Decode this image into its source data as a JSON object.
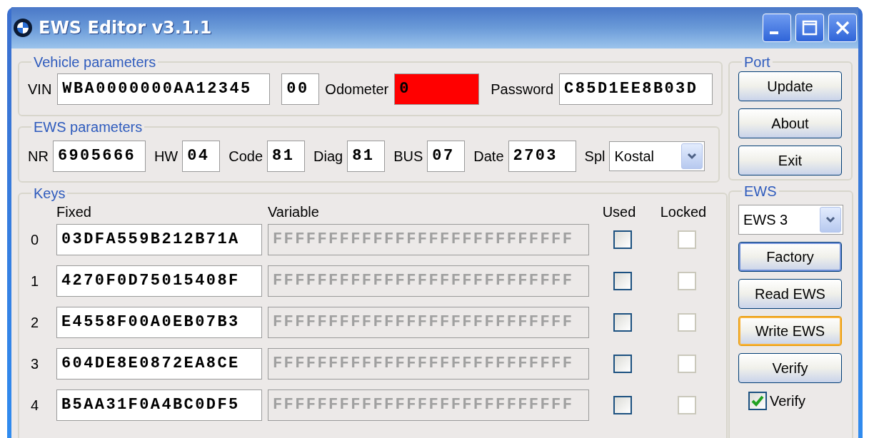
{
  "window": {
    "title": "EWS Editor v3.1.1"
  },
  "vehicle_parameters": {
    "title": "Vehicle parameters",
    "vin": {
      "label": "VIN",
      "value": "WBA0000000AA12345"
    },
    "vin_suffix": {
      "value": "00"
    },
    "odometer": {
      "label": "Odometer",
      "value": "0",
      "error": true
    },
    "password": {
      "label": "Password",
      "value": "C85D1EE8B03D"
    }
  },
  "ews_parameters": {
    "title": "EWS parameters",
    "fields": [
      {
        "label": "NR",
        "value": "6905666"
      },
      {
        "label": "HW",
        "value": "04"
      },
      {
        "label": "Code",
        "value": "81"
      },
      {
        "label": "Diag",
        "value": "81"
      },
      {
        "label": "BUS",
        "value": "07"
      },
      {
        "label": "Date",
        "value": "2703"
      }
    ],
    "spl": {
      "label": "Spl",
      "value": "Kostal"
    }
  },
  "keys": {
    "title": "Keys",
    "columns": [
      "Fixed",
      "Variable",
      "Used",
      "Locked"
    ],
    "rows": [
      {
        "index": "0",
        "fixed": "03DFA559B212B71A",
        "variable": "FFFFFFFFFFFFFFFFFFFFFFFFFFF",
        "variable_disabled": true,
        "used": false,
        "used_disabled": false,
        "locked": false,
        "locked_disabled": true
      },
      {
        "index": "1",
        "fixed": "4270F0D75015408F",
        "variable": "FFFFFFFFFFFFFFFFFFFFFFFFFFF",
        "variable_disabled": true,
        "used": false,
        "used_disabled": false,
        "locked": false,
        "locked_disabled": true
      },
      {
        "index": "2",
        "fixed": "E4558F00A0EB07B3",
        "variable": "FFFFFFFFFFFFFFFFFFFFFFFFFFF",
        "variable_disabled": true,
        "used": false,
        "used_disabled": false,
        "locked": false,
        "locked_disabled": true
      },
      {
        "index": "3",
        "fixed": "604DE8E0872EA8CE",
        "variable": "FFFFFFFFFFFFFFFFFFFFFFFFFFF",
        "variable_disabled": true,
        "used": false,
        "used_disabled": false,
        "locked": false,
        "locked_disabled": true
      },
      {
        "index": "4",
        "fixed": "B5AA31F0A4BC0DF5",
        "variable": "FFFFFFFFFFFFFFFFFFFFFFFFFFF",
        "variable_disabled": true,
        "used": false,
        "used_disabled": false,
        "locked": false,
        "locked_disabled": true
      }
    ]
  },
  "port": {
    "title": "Port",
    "buttons": [
      "Update",
      "About",
      "Exit"
    ]
  },
  "ews": {
    "title": "EWS",
    "select": "EWS 3",
    "buttons": [
      {
        "label": "Factory",
        "default": true,
        "hot": false
      },
      {
        "label": "Read EWS",
        "default": false,
        "hot": false
      },
      {
        "label": "Write EWS",
        "default": false,
        "hot": true
      },
      {
        "label": "Verify",
        "default": false,
        "hot": false
      }
    ],
    "verify": {
      "label": "Verify",
      "checked": true
    }
  }
}
